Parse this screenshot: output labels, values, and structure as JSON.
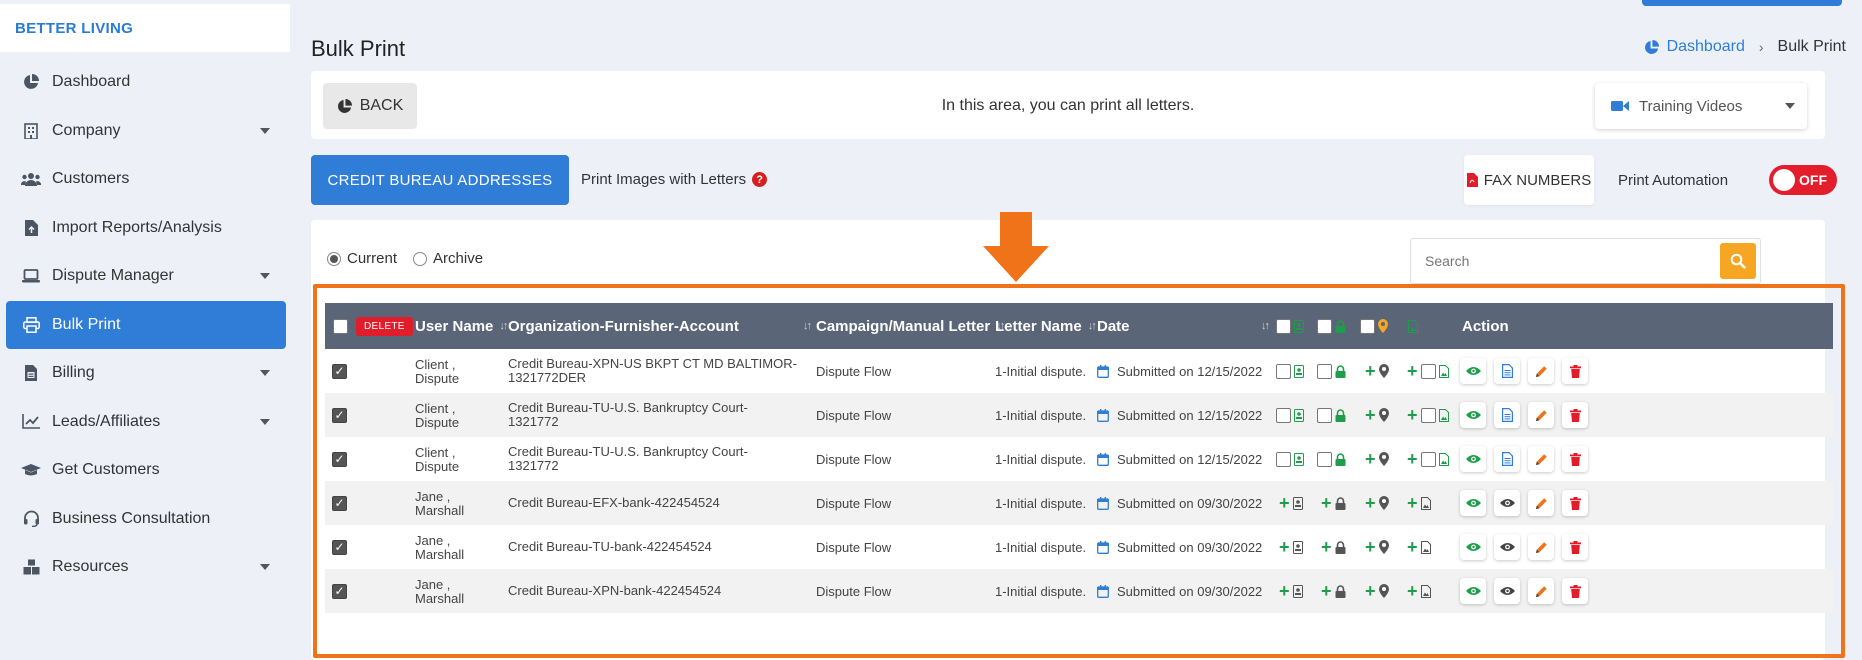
{
  "brand": "BETTER LIVING",
  "sidebar": {
    "items": [
      {
        "label": "Dashboard",
        "icon": "pie-chart-icon",
        "caret": false,
        "active": false
      },
      {
        "label": "Company",
        "icon": "building-icon",
        "caret": true,
        "active": false
      },
      {
        "label": "Customers",
        "icon": "users-icon",
        "caret": false,
        "active": false
      },
      {
        "label": "Import Reports/Analysis",
        "icon": "file-import-icon",
        "caret": false,
        "active": false
      },
      {
        "label": "Dispute Manager",
        "icon": "laptop-icon",
        "caret": true,
        "active": false
      },
      {
        "label": "Bulk Print",
        "icon": "printer-icon",
        "caret": false,
        "active": true
      },
      {
        "label": "Billing",
        "icon": "invoice-icon",
        "caret": true,
        "active": false
      },
      {
        "label": "Leads/Affiliates",
        "icon": "line-chart-icon",
        "caret": true,
        "active": false
      },
      {
        "label": "Get Customers",
        "icon": "graduation-cap-icon",
        "caret": false,
        "active": false
      },
      {
        "label": "Business Consultation",
        "icon": "headset-icon",
        "caret": false,
        "active": false
      },
      {
        "label": "Resources",
        "icon": "boxes-icon",
        "caret": true,
        "active": false
      }
    ]
  },
  "header": {
    "title": "Bulk Print",
    "breadcrumb": {
      "home": "Dashboard",
      "current": "Bulk Print"
    }
  },
  "toolbar": {
    "back_label": "BACK",
    "info_text": "In this area, you can print all letters.",
    "training_label": "Training Videos"
  },
  "actions": {
    "credit_bureau_label": "CREDIT BUREAU ADDRESSES",
    "print_images_label": "Print Images with Letters",
    "fax_label": "FAX NUMBERS",
    "automation_label": "Print Automation",
    "automation_state": "OFF"
  },
  "filters": {
    "current_label": "Current",
    "archive_label": "Archive",
    "selected": "Current",
    "search_placeholder": "Search"
  },
  "table": {
    "delete_label": "DELETE",
    "columns": {
      "user": "User Name",
      "org": "Organization-Furnisher-Account",
      "campaign": "Campaign/Manual Letter",
      "letter": "Letter Name",
      "date": "Date",
      "action": "Action"
    },
    "rows": [
      {
        "user1": "Client ,",
        "user2": "Dispute",
        "org": "Credit Bureau-XPN-US BKPT CT MD BALTIMOR-1321772DER",
        "campaign": "Dispute Flow",
        "letter": "1-Initial dispute.",
        "date": "Submitted on 12/15/2022",
        "mode": "check"
      },
      {
        "user1": "Client ,",
        "user2": "Dispute",
        "org": "Credit Bureau-TU-U.S. Bankruptcy Court-1321772",
        "campaign": "Dispute Flow",
        "letter": "1-Initial dispute.",
        "date": "Submitted on 12/15/2022",
        "mode": "check"
      },
      {
        "user1": "Client ,",
        "user2": "Dispute",
        "org": "Credit Bureau-TU-U.S. Bankruptcy Court-1321772",
        "campaign": "Dispute Flow",
        "letter": "1-Initial dispute.",
        "date": "Submitted on 12/15/2022",
        "mode": "check"
      },
      {
        "user1": "Jane ,",
        "user2": "Marshall",
        "org": "Credit Bureau-EFX-bank-422454524",
        "campaign": "Dispute Flow",
        "letter": "1-Initial dispute.",
        "date": "Submitted on 09/30/2022",
        "mode": "plus"
      },
      {
        "user1": "Jane ,",
        "user2": "Marshall",
        "org": "Credit Bureau-TU-bank-422454524",
        "campaign": "Dispute Flow",
        "letter": "1-Initial dispute.",
        "date": "Submitted on 09/30/2022",
        "mode": "plus"
      },
      {
        "user1": "Jane ,",
        "user2": "Marshall",
        "org": "Credit Bureau-XPN-bank-422454524",
        "campaign": "Dispute Flow",
        "letter": "1-Initial dispute.",
        "date": "Submitted on 09/30/2022",
        "mode": "plus"
      }
    ]
  },
  "colors": {
    "primary": "#2f7dd6",
    "highlight": "#f0731a",
    "danger": "#e11d2b",
    "header_bg": "#5a6577",
    "success": "#1f9d4a",
    "warning": "#f6a623"
  }
}
